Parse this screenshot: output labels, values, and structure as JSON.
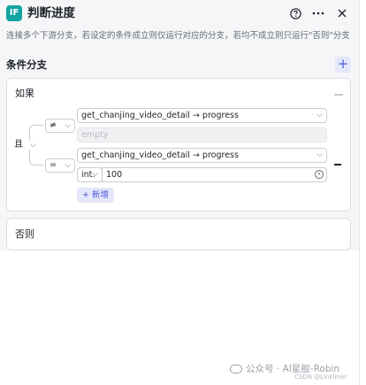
{
  "header": {
    "icon_text": "IF",
    "title": "判断进度",
    "help_icon": "question-circle-icon",
    "more_icon": "more-dots-icon",
    "close_icon": "close-icon"
  },
  "description": "连接多个下游分支，若设定的条件成立则仅运行对应的分支，若均不成立则只运行\"否则\"分支",
  "section": {
    "title": "条件分支",
    "add_label": "+"
  },
  "if_branch": {
    "title": "如果",
    "logic": "且",
    "conditions": [
      {
        "operator": "≠",
        "variable": "get_chanjing_video_detail → progress",
        "value_placeholder": "empty"
      },
      {
        "operator": "=",
        "variable": "get_chanjing_video_detail → progress",
        "value_type": "int.",
        "value": "100"
      }
    ],
    "add_condition_label": "+ 新增"
  },
  "else_branch": {
    "title": "否则"
  },
  "watermark": {
    "text": "公众号 · AI星舰-Robin",
    "credit": "CSDN @Linkliner"
  },
  "colors": {
    "accent": "#4c5bd4",
    "node_icon": "#12a3a3"
  }
}
